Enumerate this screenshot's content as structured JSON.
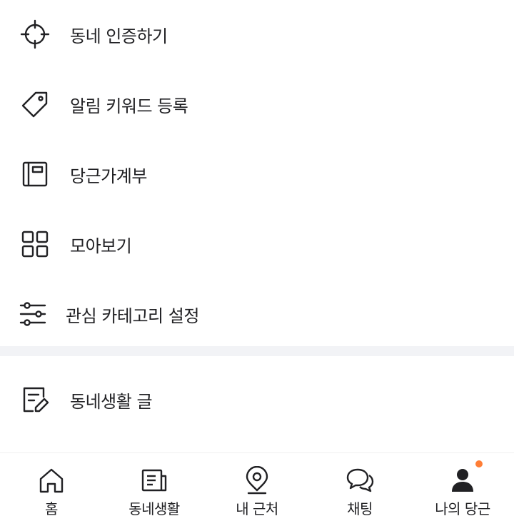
{
  "menu": {
    "items": [
      {
        "label": "동네 인증하기",
        "icon": "crosshair-icon"
      },
      {
        "label": "알림 키워드 등록",
        "icon": "tag-icon"
      },
      {
        "label": "당근가계부",
        "icon": "ledger-book-icon"
      },
      {
        "label": "모아보기",
        "icon": "grid-icon"
      },
      {
        "label": "관심 카테고리 설정",
        "icon": "sliders-icon"
      }
    ],
    "secondary_items": [
      {
        "label": "동네생활 글",
        "icon": "edit-document-icon"
      }
    ]
  },
  "bottom_nav": {
    "items": [
      {
        "label": "홈",
        "icon": "home-icon"
      },
      {
        "label": "동네생활",
        "icon": "newspaper-icon"
      },
      {
        "label": "내 근처",
        "icon": "location-pin-icon"
      },
      {
        "label": "채팅",
        "icon": "chat-bubbles-icon"
      },
      {
        "label": "나의 당근",
        "icon": "user-icon",
        "active": true,
        "has_badge": true
      }
    ]
  },
  "colors": {
    "text": "#212124",
    "divider": "#f2f3f6",
    "badge": "#ff7e36",
    "active_icon": "#212124"
  }
}
